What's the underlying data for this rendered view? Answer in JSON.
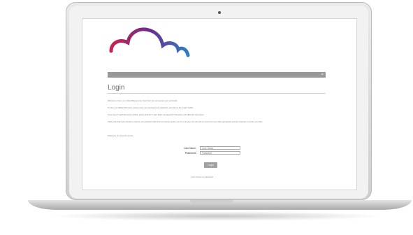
{
  "login": {
    "title": "Login",
    "bar_close": "×",
    "paragraphs": [
      "Welcome to Core, our online billing service. Next from you can access your current bill.",
      "To view your billing information, please enter your username and password, and click on the \"Login\" button.",
      "If you haven't used this service before, please click the \"I can't know my password\" link below and follow the instructions.",
      "Kindly note that if you choose to retrieve your password often from our secure system you do so at your own risk and we recommend you take appropriate security measures to protect your files.",
      "Thank you for using this service."
    ],
    "username_label": "User Name:",
    "username_placeholder": "User Name",
    "password_label": "Password:",
    "password_placeholder": "Password",
    "submit_label": "Login",
    "forgot_link": "I don't know my password"
  },
  "colors": {
    "logo_left": "#c8234b",
    "logo_mid": "#6a2c91",
    "logo_right": "#2d7fc1",
    "bar": "#999999"
  }
}
